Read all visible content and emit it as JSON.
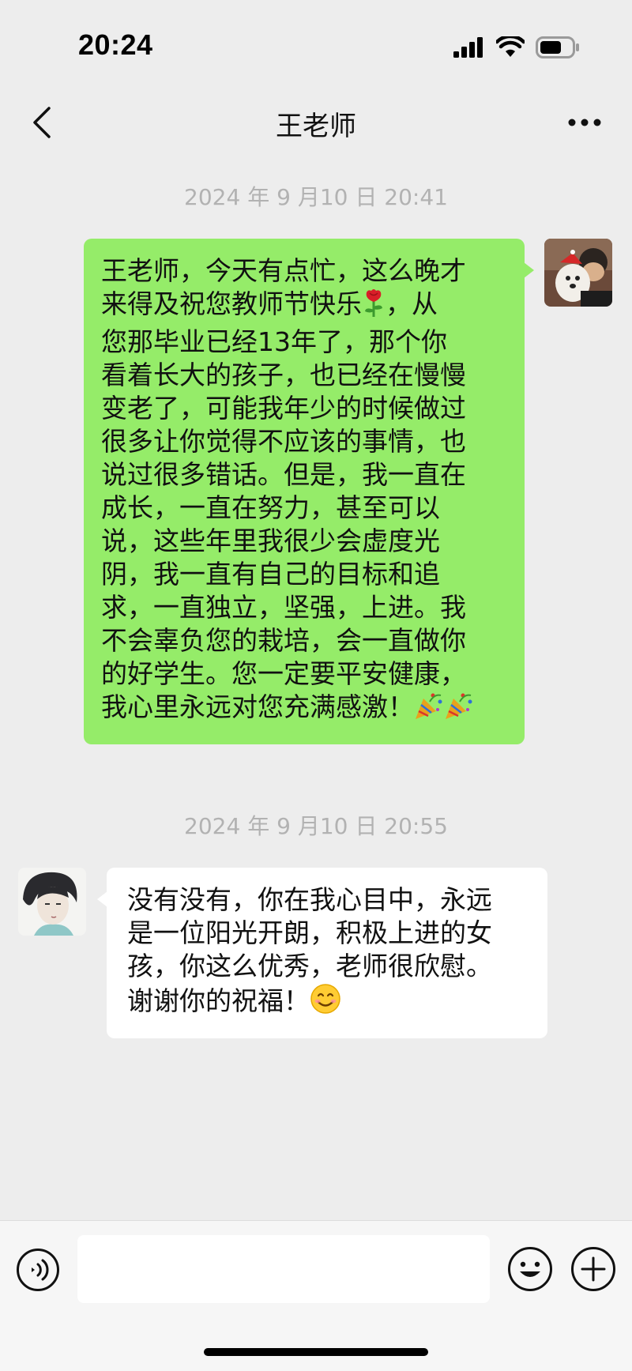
{
  "status_bar": {
    "time": "20:24"
  },
  "nav": {
    "title": "王老师"
  },
  "messages": [
    {
      "timestamp": "2024 年 9 月10 日 20:41",
      "direction": "outgoing",
      "avatar": "avatar-with-dog-photo",
      "lines": [
        "王老师，今天有点忙，这么晚才",
        "来得及祝您教师节快乐",
        "，从",
        "您那毕业已经13年了，那个你",
        "看着长大的孩子，也已经在慢慢",
        "变老了，可能我年少的时候做过",
        "很多让你觉得不应该的事情，也",
        "说过很多错话。但是，我一直在",
        "成长，一直在努力，甚至可以",
        "说，这些年里我很少会虚度光",
        "阴，我一直有自己的目标和追",
        "求，一直独立，坚强，上进。我",
        "不会辜负您的栽培，会一直做你",
        "的好学生。您一定要平安健康，",
        "我心里永远对您充满感激！"
      ],
      "emojis": [
        "rose-emoji",
        "party-popper-emoji",
        "party-popper-emoji"
      ]
    },
    {
      "timestamp": "2024 年 9 月10 日 20:55",
      "direction": "incoming",
      "avatar": "avatar-anime-illustration",
      "lines": [
        "没有没有，你在我心目中，永远",
        "是一位阳光开朗，积极上进的女",
        "孩，你这么优秀，老师很欣慰。",
        "谢谢你的祝福！"
      ],
      "emojis": [
        "smiling-face-emoji"
      ]
    }
  ],
  "input": {
    "value": "",
    "placeholder": ""
  },
  "colors": {
    "outgoing_bubble": "#95ec69",
    "incoming_bubble": "#ffffff",
    "background": "#ededed",
    "timestamp_text": "#b2b2b2"
  },
  "icons": [
    "back-chevron-icon",
    "more-dots-icon",
    "voice-icon",
    "emoji-icon",
    "plus-icon"
  ]
}
